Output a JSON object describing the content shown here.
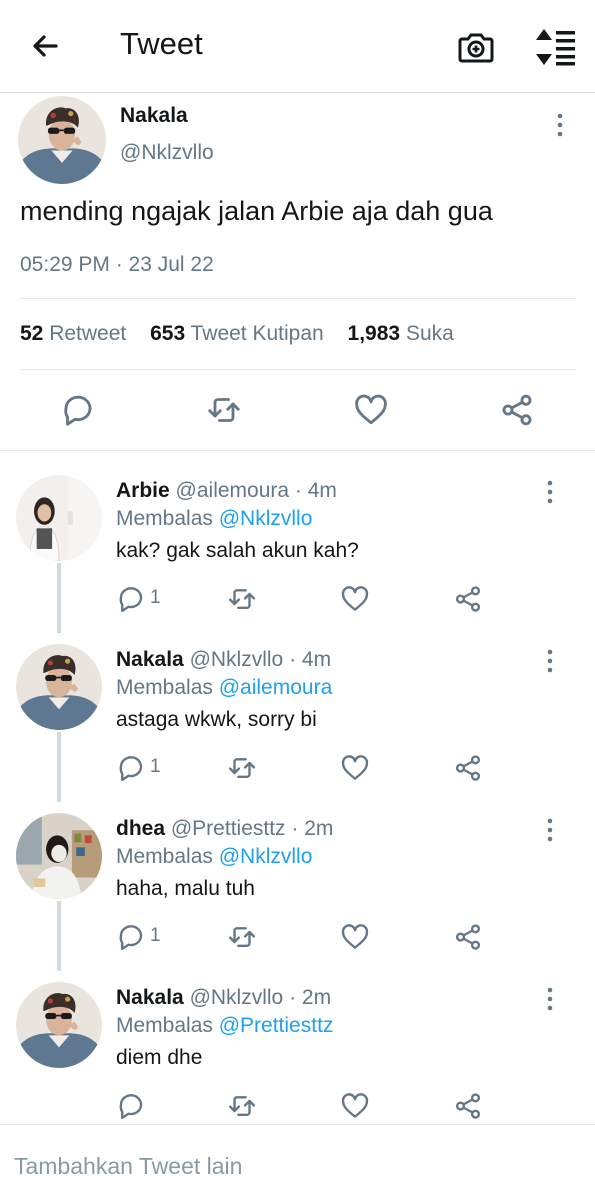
{
  "header": {
    "title": "Tweet",
    "back_icon": "arrow-left-icon",
    "camera_icon": "camera-icon",
    "sort_icon": "sort-icon"
  },
  "main_tweet": {
    "name": "Nakala",
    "handle": "@Nklzvllo",
    "text": "mending ngajak jalan Arbie aja dah gua",
    "timestamp": "05:29 PM · 23 Jul 22",
    "stats": {
      "retweets_count": "52",
      "retweets_label": "Retweet",
      "quotes_count": "653",
      "quotes_label": "Tweet Kutipan",
      "likes_count": "1,983",
      "likes_label": "Suka"
    }
  },
  "replies": [
    {
      "name": "Arbie",
      "handle": "@ailemoura",
      "time": "· 4m",
      "replying_label": "Membalas",
      "replying_to": "@Nklzvllo",
      "text": "kak? gak salah akun kah?",
      "reply_count": "1"
    },
    {
      "name": "Nakala",
      "handle": "@Nklzvllo",
      "time": "· 4m",
      "replying_label": "Membalas",
      "replying_to": "@ailemoura",
      "text": "astaga wkwk, sorry bi",
      "reply_count": "1"
    },
    {
      "name": "dhea",
      "handle": "@Prettiesttz",
      "time": "· 2m",
      "replying_label": "Membalas",
      "replying_to": "@Nklzvllo",
      "text": "haha, malu tuh",
      "reply_count": "1"
    },
    {
      "name": "Nakala",
      "handle": "@Nklzvllo",
      "time": "· 2m",
      "replying_label": "Membalas",
      "replying_to": "@Prettiesttz",
      "text": "diem dhe",
      "reply_count": ""
    }
  ],
  "compose": {
    "placeholder": "Tambahkan Tweet lain"
  },
  "colors": {
    "text_primary": "#14171a",
    "text_secondary": "#657786",
    "link": "#1da1f2",
    "divider": "#e1e8ed"
  }
}
